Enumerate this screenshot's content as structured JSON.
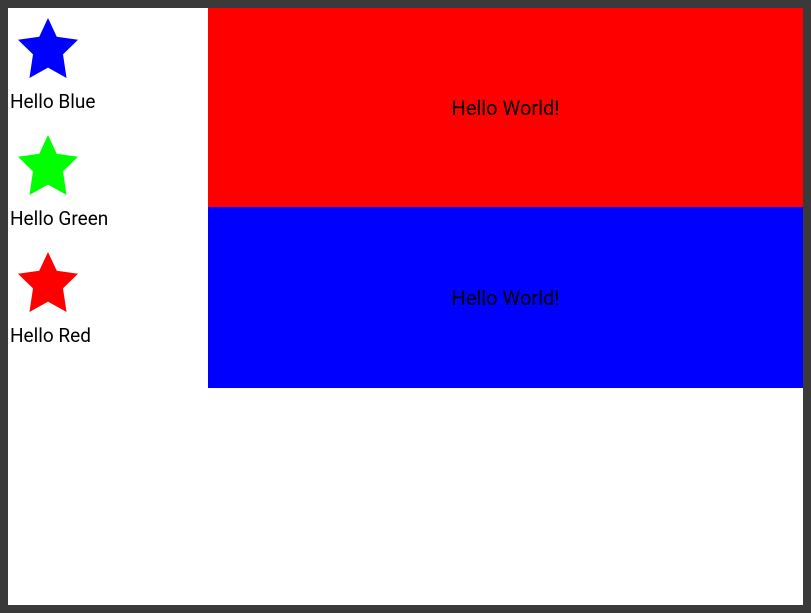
{
  "sidebar": {
    "items": [
      {
        "label": "Hello Blue",
        "color": "#0000ff"
      },
      {
        "label": "Hello Green",
        "color": "#00ff00"
      },
      {
        "label": "Hello Red",
        "color": "#ff0000"
      }
    ]
  },
  "panels": {
    "red": {
      "text": "Hello World!",
      "bg": "#ff0000"
    },
    "blue": {
      "text": "Hello World!",
      "bg": "#0000ff"
    }
  }
}
